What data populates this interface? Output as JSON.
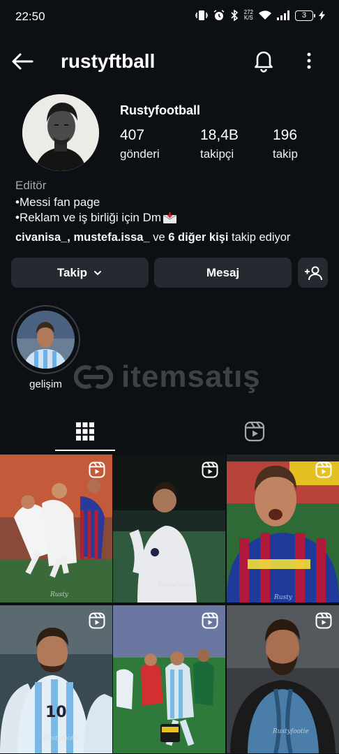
{
  "status_bar": {
    "time": "22:50",
    "speed_value": "272",
    "speed_unit": "K/S",
    "battery": "3"
  },
  "header": {
    "username": "rustyftball",
    "back_icon": "arrow-left-icon",
    "bell_icon": "bell-icon",
    "more_icon": "more-vertical-icon"
  },
  "profile": {
    "display_name": "Rustyfootball",
    "stats": [
      {
        "value": "407",
        "label": "gönderi"
      },
      {
        "value": "18,4B",
        "label": "takipçi"
      },
      {
        "value": "196",
        "label": "takip"
      }
    ],
    "category": "Editör",
    "bio_line1": "•Messi fan page",
    "bio_line2": "•Reklam ve iş birliği için Dm",
    "followed_by_names": "civanisa_, mustefa.issa_",
    "followed_by_and": " ve ",
    "followed_by_others": "6 diğer kişi",
    "followed_by_suffix": " takip ediyor"
  },
  "buttons": {
    "follow": "Takip",
    "message": "Mesaj",
    "add_user_icon": "add-user-icon"
  },
  "highlights": [
    {
      "label": "gelişim"
    }
  ],
  "watermark": {
    "text": "itemsatış"
  },
  "tabs": [
    {
      "icon": "grid-icon",
      "active": true
    },
    {
      "icon": "reels-icon",
      "active": false
    }
  ],
  "colors": {
    "background": "#0c1014",
    "button": "#262a30",
    "muted": "#a8a8a8"
  }
}
